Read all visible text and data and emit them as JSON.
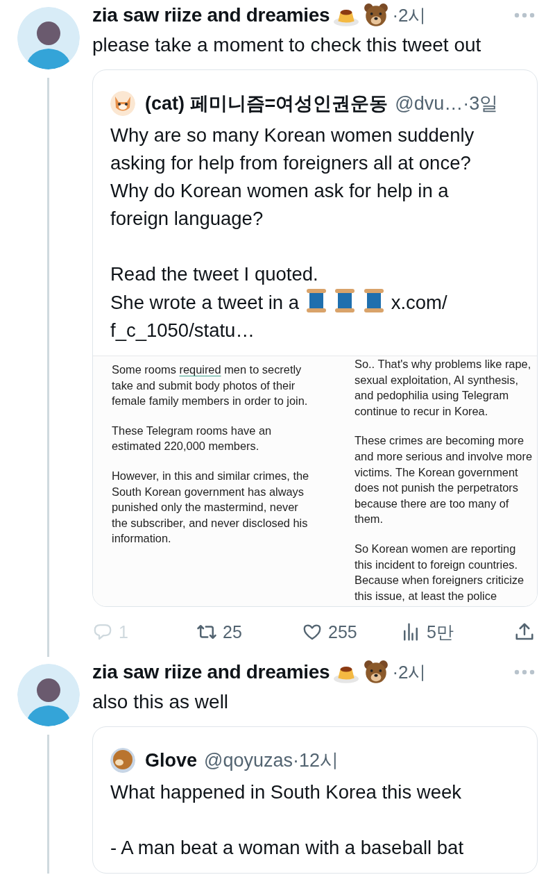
{
  "tweets": [
    {
      "author": "zia saw riize and dreamies",
      "badges": [
        {
          "kind": "pudding"
        },
        {
          "kind": "bear"
        }
      ],
      "time": "·2시",
      "text": "please take a moment to check this tweet out",
      "quote": {
        "avatar": {
          "kind": "cat"
        },
        "author": "(cat) 페미니즘=여성인권운동",
        "handle": "@dvu…",
        "time": "·3일",
        "paragraphs": [
          [
            {
              "kind": "text",
              "text": "Why are so many Korean women suddenly asking for help from foreigners all at once? Why do Korean women ask for help in a foreign language?"
            }
          ],
          [
            {
              "kind": "text",
              "text": "Read the tweet I quoted."
            },
            {
              "kind": "break"
            },
            {
              "kind": "text",
              "text": "She wrote a tweet in a"
            },
            {
              "kind": "spool"
            },
            {
              "kind": "spool"
            },
            {
              "kind": "spool"
            },
            {
              "kind": "text",
              "text": "x.com/"
            },
            {
              "kind": "text",
              "text": "f_c_1050/statu…"
            }
          ]
        ],
        "image": {
          "columns": [
            [
              [
                {
                  "text": "Some rooms "
                },
                {
                  "text": "required",
                  "underlined": true
                },
                {
                  "text": " men to secretly take and submit body photos of their female family members in order to join."
                }
              ],
              [
                {
                  "text": "These Telegram rooms have an estimated 220,000 members."
                }
              ],
              [
                {
                  "text": "However, in this and similar crimes, the South Korean government has always punished only the mastermind, never the subscriber, and never disclosed his information."
                }
              ]
            ],
            [
              [
                {
                  "text": "So.. That's why problems like rape, sexual exploitation, AI synthesis, and pedophilia using Telegram continue to recur in Korea."
                }
              ],
              [
                {
                  "text": "These crimes are becoming more and more serious and involve more victims. The Korean government does not punish the perpetrators because there are too many of them."
                }
              ],
              [
                {
                  "text": "So Korean women are reporting this incident to foreign countries. Because when foreigners criticize this issue, at least the police"
                }
              ]
            ]
          ]
        }
      },
      "actions": [
        {
          "kind": "reply",
          "count": "1",
          "disabled": true
        },
        {
          "kind": "retweet",
          "count": "25",
          "disabled": false
        },
        {
          "kind": "like",
          "count": "255",
          "disabled": false
        },
        {
          "kind": "views",
          "count": "5만",
          "disabled": false
        },
        {
          "kind": "share",
          "disabled": false
        }
      ]
    },
    {
      "author": "zia saw riize and dreamies",
      "badges": [
        {
          "kind": "pudding"
        },
        {
          "kind": "bear"
        }
      ],
      "time": "·2시",
      "text": "also this as well",
      "quote": {
        "avatar": {
          "kind": "bear"
        },
        "author": "Glove",
        "handle": "@qoyuzas",
        "time": "·12시",
        "paragraphs": [
          [
            {
              "kind": "text",
              "text": "What happened in South Korea this week"
            }
          ],
          [
            {
              "kind": "text",
              "text": "- A man beat a woman with a baseball bat"
            }
          ]
        ]
      }
    }
  ]
}
